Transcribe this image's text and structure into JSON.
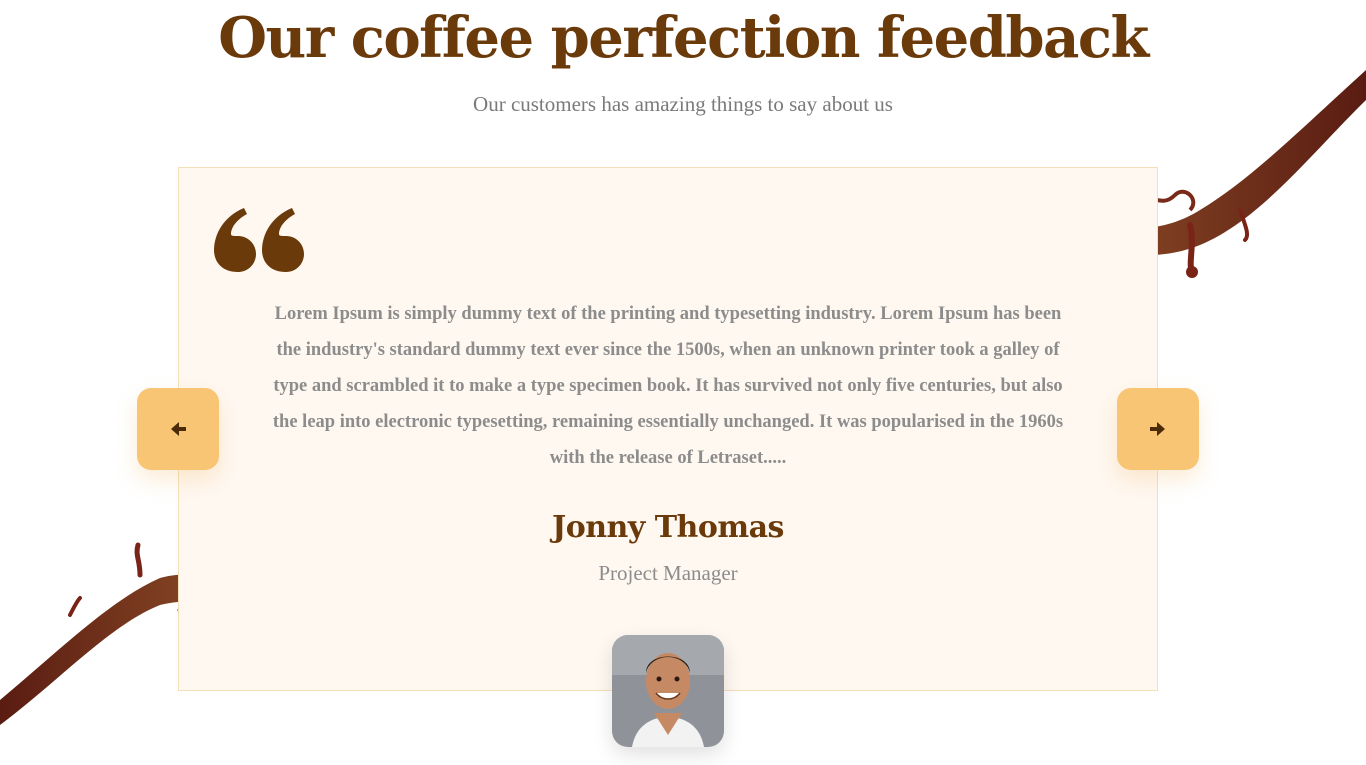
{
  "section": {
    "title": "Our coffee perfection feedback",
    "subtitle": "Our customers has amazing things to say about us"
  },
  "testimonial": {
    "quote_icon": "quote-icon",
    "text": "Lorem Ipsum is simply dummy text of the printing and typesetting industry. Lorem Ipsum has been the industry's standard dummy text ever since the 1500s, when an unknown printer took a galley of type and scrambled it to make a type specimen book. It has survived not only five centuries, but also the leap into electronic typesetting, remaining essentially unchanged. It was popularised in the 1960s with the release of Letraset.....",
    "author_name": "Jonny Thomas",
    "author_role": "Project Manager"
  },
  "navigation": {
    "prev_icon": "arrow-left-icon",
    "next_icon": "arrow-right-icon"
  },
  "colors": {
    "title": "#6b3a0a",
    "accent": "#f8c575",
    "card_bg": "#fff8f1",
    "body_text": "#8c8c8c"
  }
}
